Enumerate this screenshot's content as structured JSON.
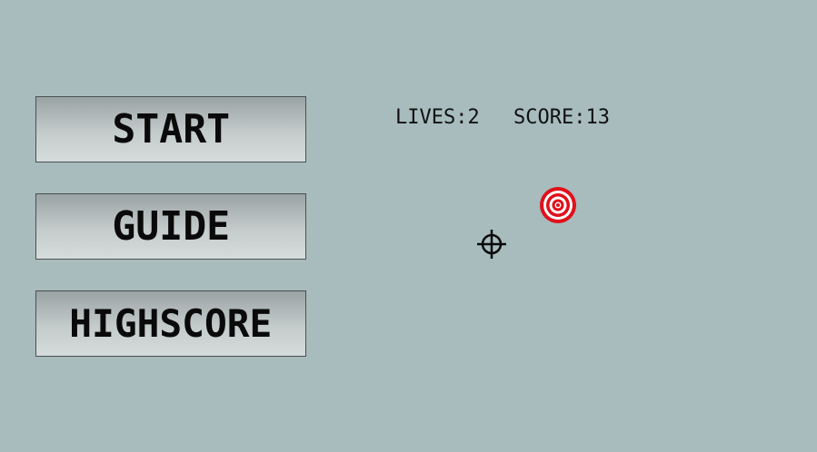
{
  "menu": {
    "start_label": "START",
    "guide_label": "GUIDE",
    "highscore_label": "HIGHSCORE"
  },
  "hud": {
    "lives_label": "LIVES:",
    "lives": 2,
    "score_label": "SCORE:",
    "score": 13
  },
  "game": {
    "target_icon": "bullseye-target-icon",
    "cursor_icon": "crosshair-icon"
  },
  "colors": {
    "background": "#a8bcbd",
    "target_red": "#e0101a",
    "target_white": "#ffffff",
    "text": "#111111"
  }
}
